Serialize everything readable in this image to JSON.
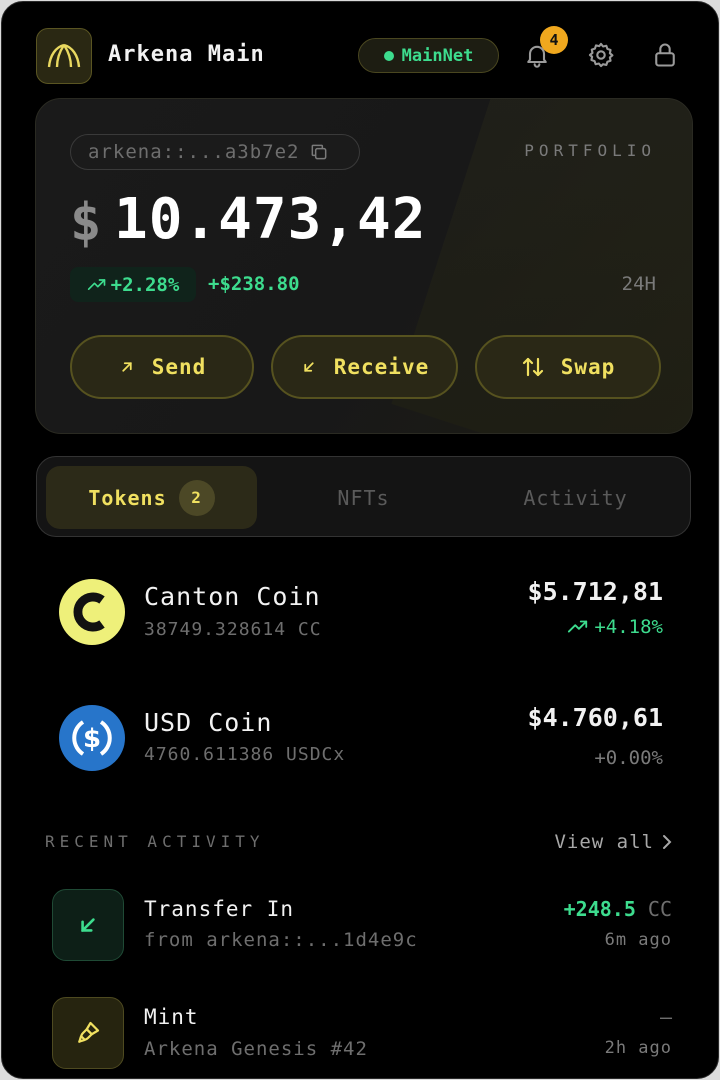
{
  "header": {
    "wallet_name": "Arkena Main",
    "network": "MainNet",
    "notification_count": "4"
  },
  "portfolio": {
    "address": "arkena::...a3b7e2",
    "label": "PORTFOLIO",
    "currency_symbol": "$",
    "balance": "10.473,42",
    "change_percent": "+2.28%",
    "change_amount": "+$238.80",
    "period": "24H",
    "actions": {
      "send": "Send",
      "receive": "Receive",
      "swap": "Swap"
    }
  },
  "tabs": {
    "tokens": "Tokens",
    "tokens_count": "2",
    "nfts": "NFTs",
    "activity": "Activity"
  },
  "tokens": [
    {
      "name": "Canton Coin",
      "amount": "38749.328614 CC",
      "value": "$5.712,81",
      "change": "+4.18%",
      "icon": "canton-coin-icon"
    },
    {
      "name": "USD Coin",
      "amount": "4760.611386 USDCx",
      "value": "$4.760,61",
      "change": "+0.00%",
      "icon": "usd-coin-icon"
    }
  ],
  "recent_activity": {
    "label": "RECENT ACTIVITY",
    "view_all": "View all",
    "items": [
      {
        "title": "Transfer In",
        "subtitle": "from arkena::...1d4e9c",
        "amount": "+248.5",
        "unit": "CC",
        "time": "6m ago"
      },
      {
        "title": "Mint",
        "subtitle": "Arkena Genesis #42",
        "amount": "—",
        "unit": "",
        "time": "2h ago"
      }
    ]
  },
  "colors": {
    "accent": "#f0e060",
    "positive": "#3ddc8e",
    "badge": "#f0a81e",
    "usdc_blue": "#2775ca"
  }
}
